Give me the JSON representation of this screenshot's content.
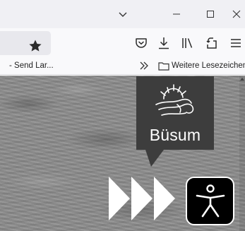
{
  "titlebar": {
    "icons": [
      "chevron-down-icon",
      "minimize-icon",
      "maximize-icon",
      "close-icon"
    ]
  },
  "toolbar": {
    "icons": [
      "bookmark-star-icon",
      "pocket-icon",
      "download-icon",
      "library-icon",
      "share-icon",
      "menu-icon"
    ]
  },
  "bookmarks": {
    "left_item": "- Send Lar...",
    "other_label": "Weitere Lesezeichen"
  },
  "page": {
    "badge_text": "Büsum",
    "badge_color": "#3d3d3d",
    "arrow_color": "#ffffff",
    "accessibility_icon": "accessibility-person-icon"
  }
}
